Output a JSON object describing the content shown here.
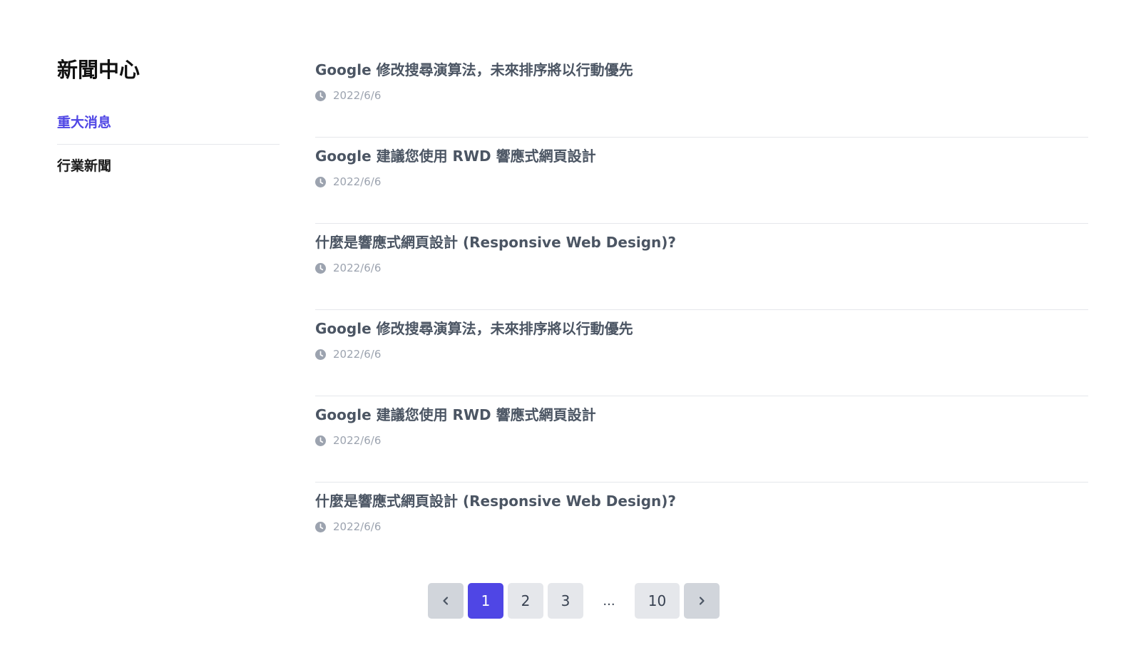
{
  "sidebar": {
    "title": "新聞中心",
    "items": [
      {
        "label": "重大消息",
        "active": true
      },
      {
        "label": "行業新聞",
        "active": false
      }
    ]
  },
  "news": {
    "items": [
      {
        "title": "Google 修改搜尋演算法，未來排序將以行動優先",
        "date": "2022/6/6"
      },
      {
        "title": "Google 建議您使用 RWD 響應式網頁設計",
        "date": "2022/6/6"
      },
      {
        "title": "什麼是響應式網頁設計 (Responsive Web Design)?",
        "date": "2022/6/6"
      },
      {
        "title": "Google 修改搜尋演算法，未來排序將以行動優先",
        "date": "2022/6/6"
      },
      {
        "title": "Google 建議您使用 RWD 響應式網頁設計",
        "date": "2022/6/6"
      },
      {
        "title": "什麼是響應式網頁設計 (Responsive Web Design)?",
        "date": "2022/6/6"
      }
    ]
  },
  "pagination": {
    "prev_icon": "chevron-left-icon",
    "next_icon": "chevron-right-icon",
    "pages": [
      "1",
      "2",
      "3"
    ],
    "ellipsis": "...",
    "last_page": "10",
    "current": "1"
  },
  "colors": {
    "accent": "#4f46e5",
    "title_text": "#4b5563",
    "meta_text": "#9ca3af",
    "divider": "#e5e7eb"
  }
}
